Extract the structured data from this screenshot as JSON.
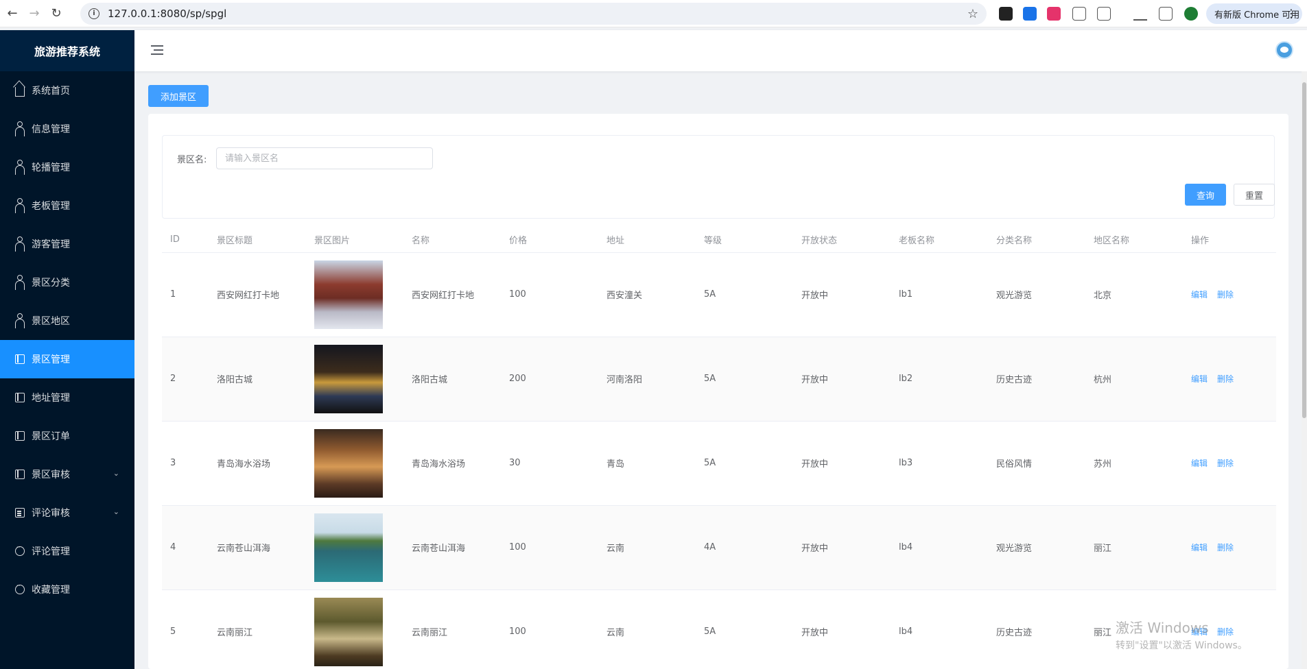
{
  "browser": {
    "url": "127.0.0.1:8080/sp/spgl",
    "update_label": "有新版 Chrome 可用"
  },
  "sidebar": {
    "brand": "旅游推荐系统",
    "items": [
      {
        "label": "系统首页",
        "icon": "home-icon"
      },
      {
        "label": "信息管理",
        "icon": "user-icon"
      },
      {
        "label": "轮播管理",
        "icon": "user-icon"
      },
      {
        "label": "老板管理",
        "icon": "user-icon"
      },
      {
        "label": "游客管理",
        "icon": "user-icon"
      },
      {
        "label": "景区分类",
        "icon": "user-icon"
      },
      {
        "label": "景区地区",
        "icon": "user-icon"
      },
      {
        "label": "景区管理",
        "icon": "document-icon",
        "active": true
      },
      {
        "label": "地址管理",
        "icon": "document-icon"
      },
      {
        "label": "景区订单",
        "icon": "document-icon"
      },
      {
        "label": "景区审核",
        "icon": "document-icon",
        "expandable": true
      },
      {
        "label": "评论审核",
        "icon": "list-icon",
        "expandable": true
      },
      {
        "label": "评论管理",
        "icon": "chat-icon"
      },
      {
        "label": "收藏管理",
        "icon": "chat-icon"
      }
    ]
  },
  "toolbar": {
    "add_label": "添加景区"
  },
  "search": {
    "label": "景区名:",
    "placeholder": "请输入景区名",
    "value": "",
    "query_label": "查询",
    "reset_label": "重置"
  },
  "table": {
    "columns": [
      "ID",
      "景区标题",
      "景区图片",
      "名称",
      "价格",
      "地址",
      "等级",
      "开放状态",
      "老板名称",
      "分类名称",
      "地区名称",
      "操作"
    ],
    "edit_label": "编辑",
    "delete_label": "删除",
    "rows": [
      {
        "id": "1",
        "title": "西安网红打卡地",
        "name": "西安网红打卡地",
        "price": "100",
        "address": "西安潼关",
        "level": "5A",
        "status": "开放中",
        "boss": "lb1",
        "category": "观光游览",
        "region": "北京"
      },
      {
        "id": "2",
        "title": "洛阳古城",
        "name": "洛阳古城",
        "price": "200",
        "address": "河南洛阳",
        "level": "5A",
        "status": "开放中",
        "boss": "lb2",
        "category": "历史古迹",
        "region": "杭州"
      },
      {
        "id": "3",
        "title": "青岛海水浴场",
        "name": "青岛海水浴场",
        "price": "30",
        "address": "青岛",
        "level": "5A",
        "status": "开放中",
        "boss": "lb3",
        "category": "民俗风情",
        "region": "苏州"
      },
      {
        "id": "4",
        "title": "云南苍山洱海",
        "name": "云南苍山洱海",
        "price": "100",
        "address": "云南",
        "level": "4A",
        "status": "开放中",
        "boss": "lb4",
        "category": "观光游览",
        "region": "丽江"
      },
      {
        "id": "5",
        "title": "云南丽江",
        "name": "云南丽江",
        "price": "100",
        "address": "云南",
        "level": "5A",
        "status": "开放中",
        "boss": "lb4",
        "category": "历史古迹",
        "region": "丽江"
      }
    ]
  },
  "watermark": {
    "line1": "激活 Windows",
    "line2": "转到\"设置\"以激活 Windows。"
  },
  "colors": {
    "sidebar_bg": "#001529",
    "active": "#1890ff",
    "primary": "#409eff"
  }
}
